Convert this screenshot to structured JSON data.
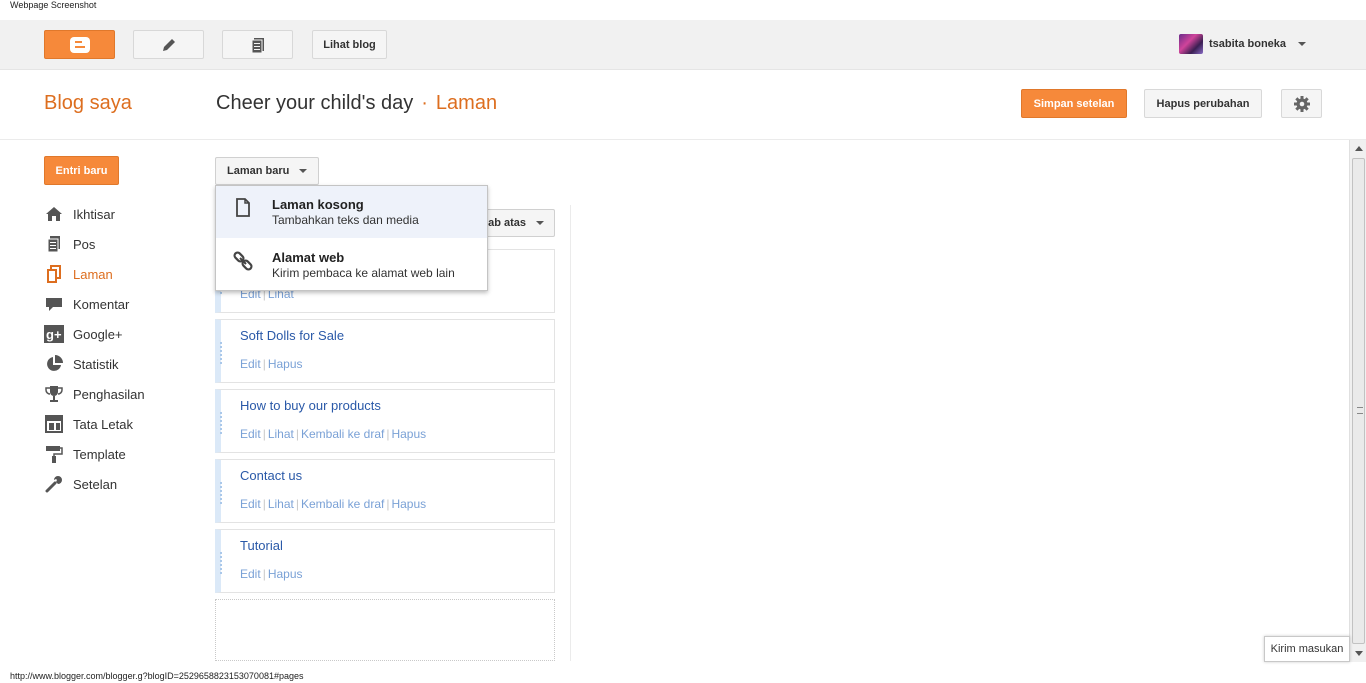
{
  "caption": "Webpage Screenshot",
  "topbar": {
    "view_blog_label": "Lihat blog",
    "user_name": "tsabita boneka"
  },
  "header": {
    "my_blog": "Blog saya",
    "blog_title": "Cheer your child's day",
    "separator": "·",
    "section": "Laman",
    "save_label": "Simpan setelan",
    "discard_label": "Hapus perubahan"
  },
  "sidebar": {
    "new_post_label": "Entri baru",
    "items": [
      {
        "label": "Ikhtisar",
        "icon": "home-icon"
      },
      {
        "label": "Pos",
        "icon": "posts-icon"
      },
      {
        "label": "Laman",
        "icon": "pages-icon",
        "active": true
      },
      {
        "label": "Komentar",
        "icon": "comment-icon"
      },
      {
        "label": "Google+",
        "icon": "google-plus-icon"
      },
      {
        "label": "Statistik",
        "icon": "pie-chart-icon"
      },
      {
        "label": "Penghasilan",
        "icon": "trophy-icon"
      },
      {
        "label": "Tata Letak",
        "icon": "layout-icon"
      },
      {
        "label": "Template",
        "icon": "paint-roller-icon"
      },
      {
        "label": "Setelan",
        "icon": "wrench-icon"
      }
    ]
  },
  "main": {
    "new_page_label": "Laman baru",
    "show_tabs_label": "ab atas",
    "dropdown": [
      {
        "title": "Laman kosong",
        "subtitle": "Tambahkan teks dan media"
      },
      {
        "title": "Alamat web",
        "subtitle": "Kirim pembaca ke alamat web lain"
      }
    ],
    "pages": [
      {
        "title": "",
        "links": [
          "Edit",
          "Lihat"
        ]
      },
      {
        "title": "Soft Dolls for Sale",
        "links": [
          "Edit",
          "Hapus"
        ]
      },
      {
        "title": "How to buy our products",
        "links": [
          "Edit",
          "Lihat",
          "Kembali ke draf",
          "Hapus"
        ]
      },
      {
        "title": "Contact us",
        "links": [
          "Edit",
          "Lihat",
          "Kembali ke draf",
          "Hapus"
        ]
      },
      {
        "title": "Tutorial",
        "links": [
          "Edit",
          "Hapus"
        ]
      }
    ]
  },
  "feedback_label": "Kirim masukan",
  "status_url": "http://www.blogger.com/blogger.g?blogID=2529658823153070081#pages"
}
